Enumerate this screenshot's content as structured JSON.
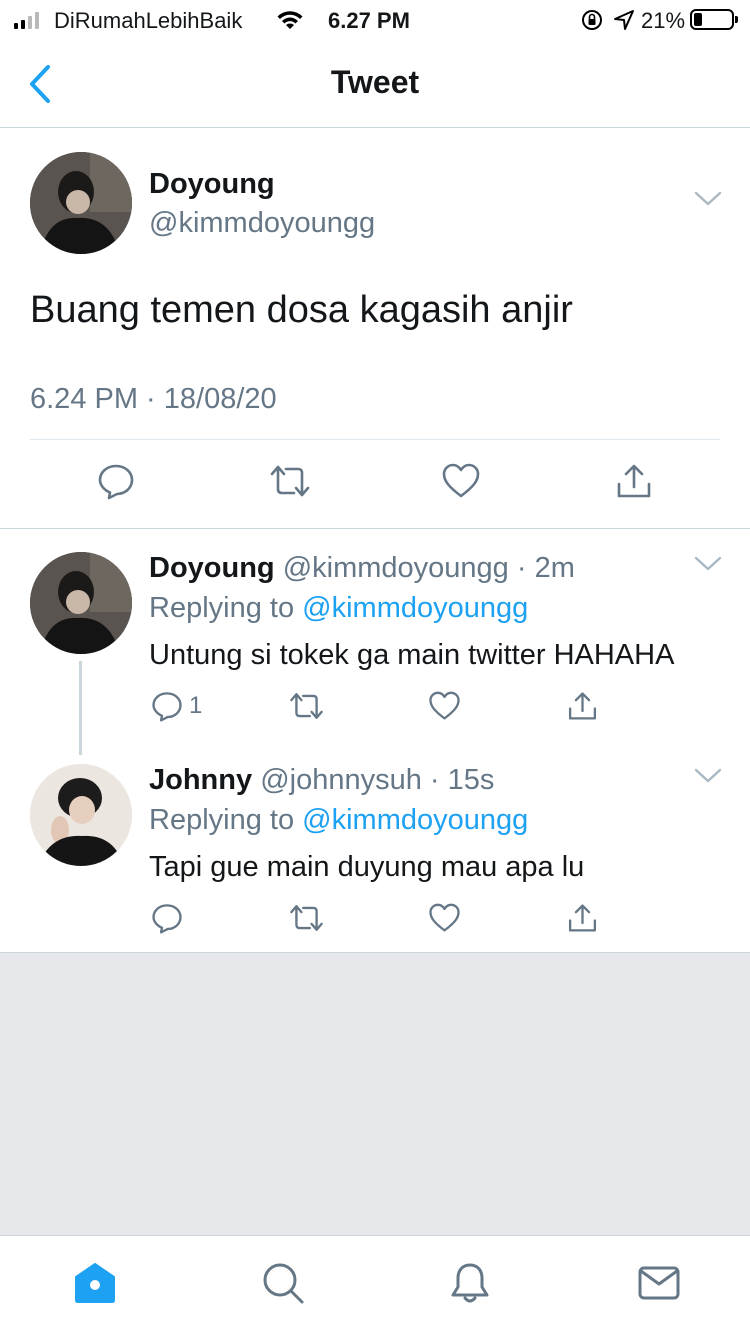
{
  "status_bar": {
    "carrier": "DiRumahLebihBaik",
    "time": "6.27 PM",
    "battery": "21%"
  },
  "nav": {
    "title": "Tweet",
    "back_icon": "chevron-left-icon"
  },
  "main_tweet": {
    "name": "Doyoung",
    "handle": "@kimmdoyoungg",
    "text": "Buang temen dosa kagasih anjir",
    "timestamp": "6.24 PM · 18/08/20",
    "actions": [
      "reply-icon",
      "retweet-icon",
      "like-icon",
      "share-icon"
    ]
  },
  "replies": [
    {
      "name": "Doyoung",
      "handle": "@kimmdoyoungg",
      "separator": "·",
      "age": "2m",
      "replying_prefix": "Replying to",
      "replying_to": "@kimmdoyoungg",
      "text": "Untung si tokek ga main twitter HAHAHA",
      "reply_count": "1"
    },
    {
      "name": "Johnny",
      "handle": "@johnnysuh",
      "separator": "·",
      "age": "15s",
      "replying_prefix": "Replying to",
      "replying_to": "@kimmdoyoungg",
      "text": "Tapi gue main duyung mau apa lu",
      "reply_count": ""
    }
  ],
  "tab_bar": [
    "home-icon",
    "search-icon",
    "notifications-icon",
    "messages-icon"
  ],
  "colors": {
    "accent": "#1da1f2",
    "secondary_text": "#657786",
    "icon": "#657786",
    "tab_active": "#1da1f2"
  }
}
